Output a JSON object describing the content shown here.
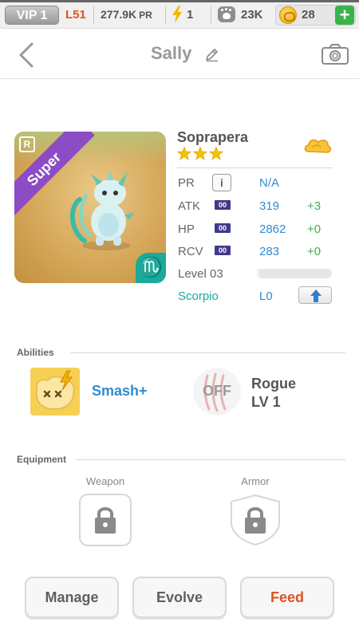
{
  "statusbar": {
    "vip": "VIP 1",
    "level": "L51",
    "pr_value": "277.9K",
    "pr_unit": "PR",
    "energy": "1",
    "paws": "23K",
    "coins": "28",
    "add": "+"
  },
  "header": {
    "title": "Sally"
  },
  "pet": {
    "rarity": "Super",
    "rarity_badge": "R",
    "zodiac_symbol": "♏",
    "species": "Soprapera",
    "stars": 3,
    "stats": {
      "pr": {
        "label": "PR",
        "info": "i",
        "value": "N/A"
      },
      "atk": {
        "label": "ATK",
        "badge": "00",
        "value": "319",
        "bonus": "+3"
      },
      "hp": {
        "label": "HP",
        "badge": "00",
        "value": "2862",
        "bonus": "+0"
      },
      "rcv": {
        "label": "RCV",
        "badge": "00",
        "value": "283",
        "bonus": "+0"
      }
    },
    "level_label": "Level 03",
    "level_progress": 0.03,
    "zodiac_name": "Scorpio",
    "zodiac_level": "L0"
  },
  "abilities": {
    "title": "Abilities",
    "active_name": "Smash+",
    "passive_state": "OFF",
    "passive_name": "Rogue",
    "passive_level": "LV 1"
  },
  "equipment": {
    "title": "Equipment",
    "weapon_label": "Weapon",
    "armor_label": "Armor"
  },
  "actions": {
    "manage": "Manage",
    "evolve": "Evolve",
    "feed": "Feed"
  },
  "colors": {
    "accent_orange": "#e0531f",
    "value_blue": "#2f8ccf",
    "bonus_green": "#3ab34a",
    "super_purple": "#8b4cc6",
    "zodiac_teal": "#1ba99b"
  }
}
